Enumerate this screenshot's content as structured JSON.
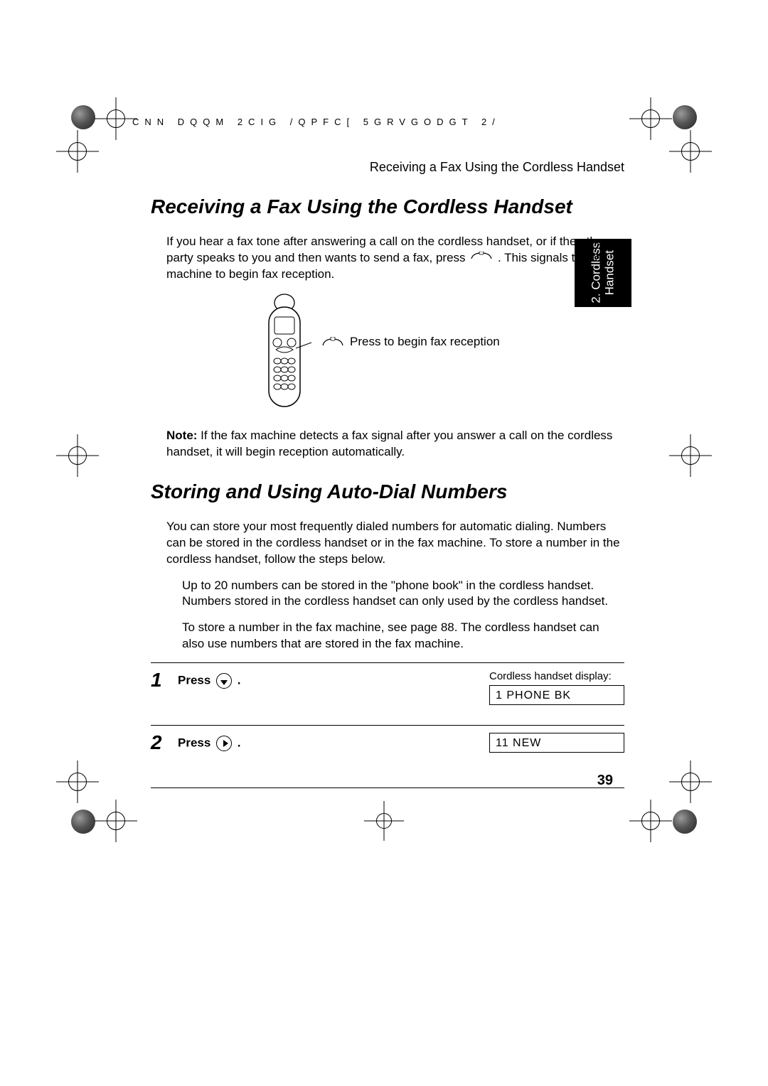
{
  "header_cipher": "CNN DQQM 2CIG    /QPFC[ 5GRVGODGT                2/",
  "running_head": "Receiving a Fax Using the Cordless Handset",
  "side_tab_line1": "2. Cordless",
  "side_tab_line2": "Handset",
  "section1": {
    "title": "Receiving a Fax Using the Cordless Handset",
    "para1_a": "If you hear a fax tone after answering a call on the cordless handset, or if the other party speaks to you and then wants to send a fax, press ",
    "para1_b": ". This signals the fax machine to begin fax reception.",
    "fax_caption": "Press to begin fax reception",
    "note_label": "Note:",
    "note_body": " If the fax machine detects a fax signal after you answer a call on the cordless handset, it will begin reception automatically."
  },
  "section2": {
    "title": "Storing and Using Auto-Dial Numbers",
    "para1": "You can store your most frequently dialed numbers for automatic dialing. Numbers can be stored in the cordless handset or in the fax machine. To store a number in the cordless handset, follow the steps below.",
    "para2": "Up to 20 numbers can be stored in the \"phone book\" in the cordless handset. Numbers stored in the cordless handset can only used by the cordless handset.",
    "para3": "To store a number in the fax machine, see page 88. The cordless handset can also use numbers that are stored in the fax machine."
  },
  "steps_display_label": "Cordless handset display:",
  "steps": [
    {
      "num": "1",
      "instr": "Press ",
      "icon": "down",
      "display": "1  PHONE BK",
      "show_head": true
    },
    {
      "num": "2",
      "instr": "Press ",
      "icon": "right",
      "display": "11 NEW",
      "show_head": false
    }
  ],
  "page_number": "39"
}
